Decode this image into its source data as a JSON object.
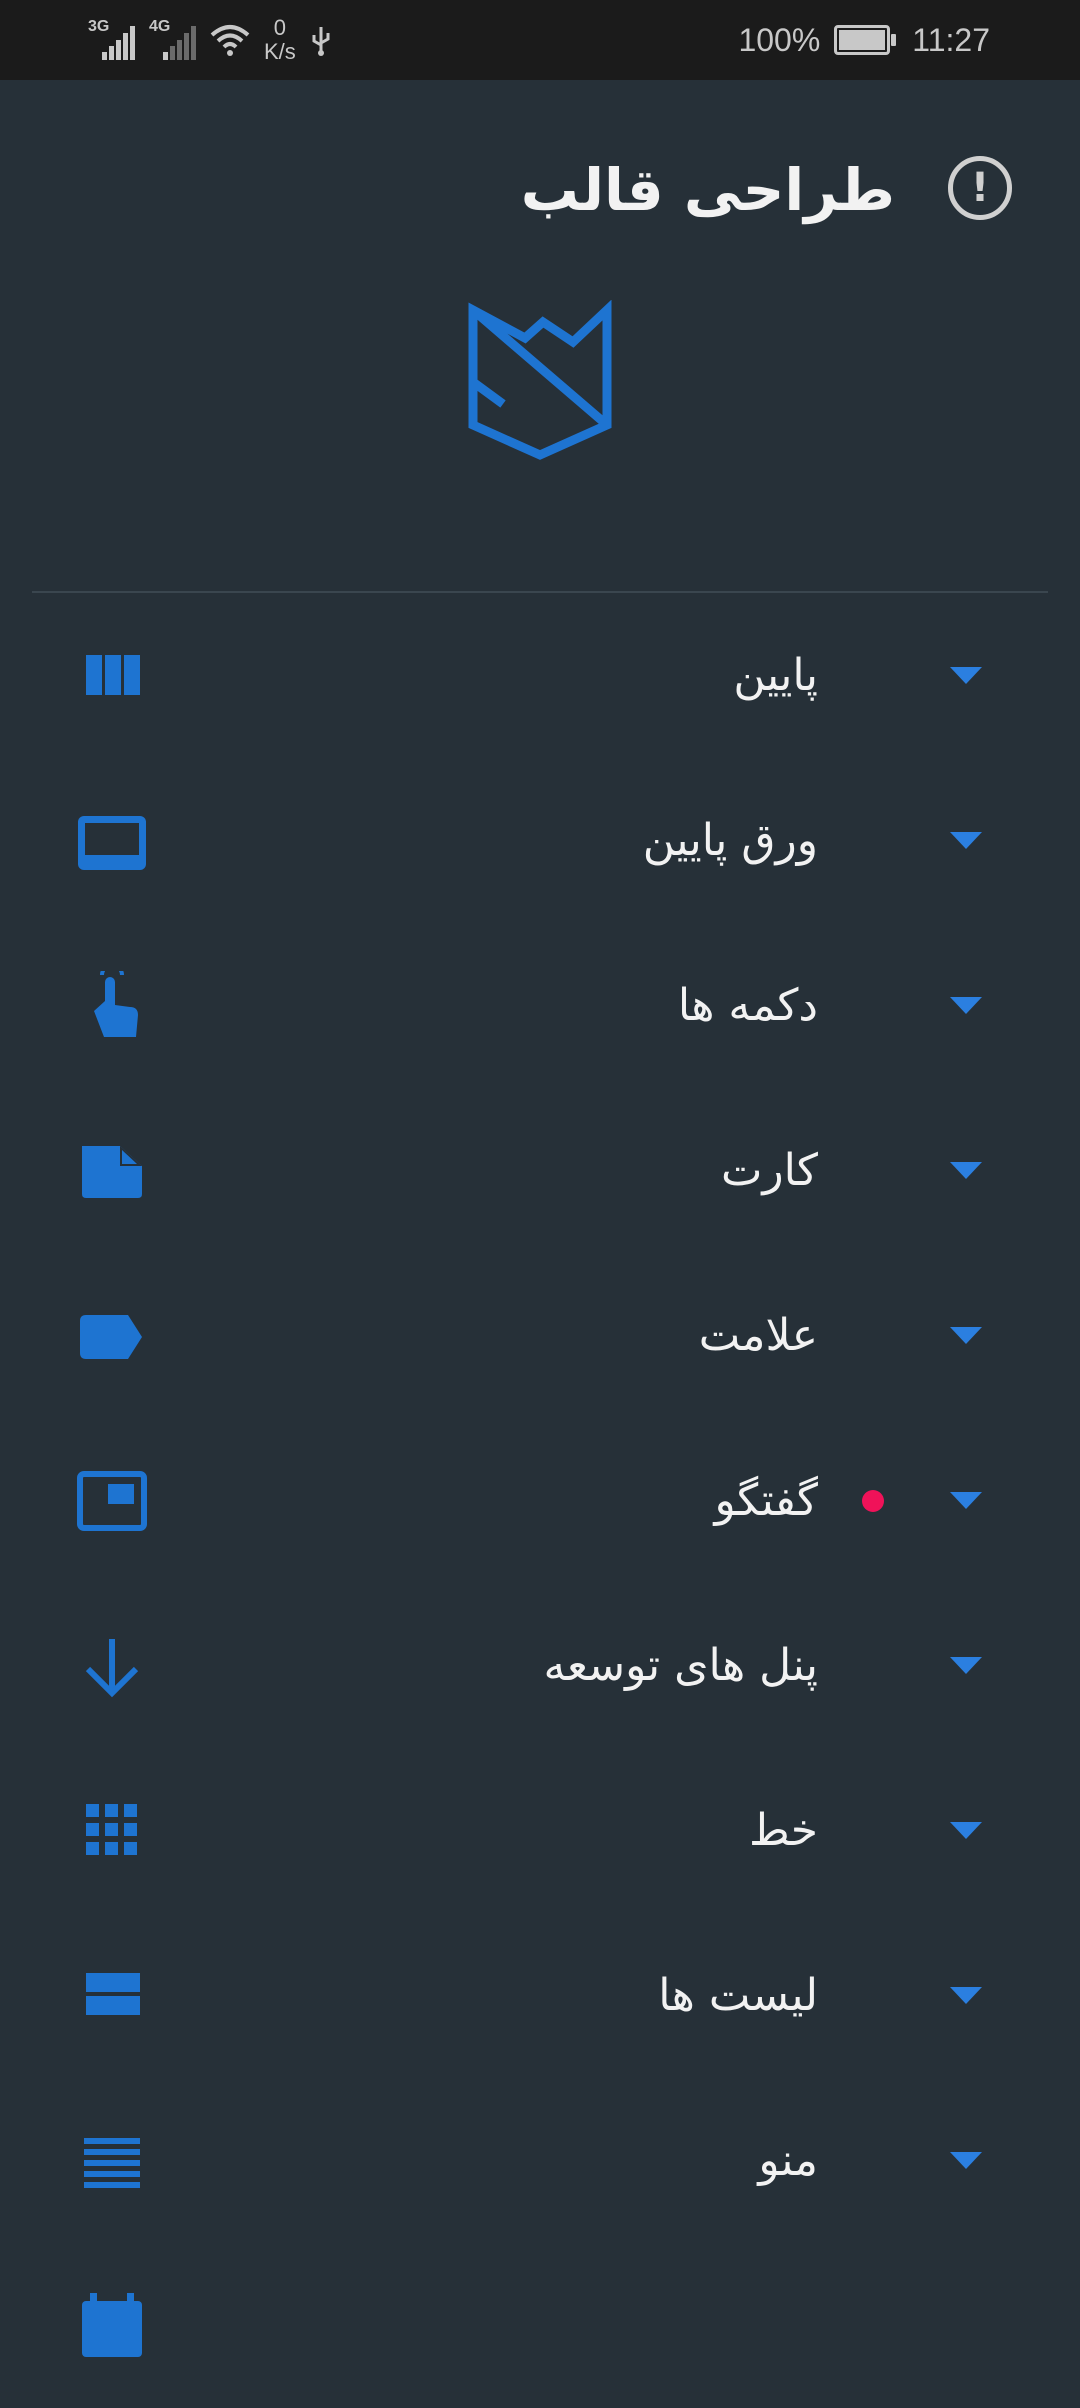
{
  "status_bar": {
    "network_1": "3G",
    "network_2": "4G",
    "speed_value": "0",
    "speed_unit": "K/s",
    "battery": "100%",
    "time": "11:27",
    "icons": [
      "signal-icon",
      "signal-weak-icon",
      "wifi-icon",
      "usb-icon",
      "battery-charging-icon"
    ]
  },
  "header": {
    "title": "طراحی قالب",
    "info_icon": "!"
  },
  "accent_color": "#2b7fe0",
  "badge_color": "#f01259",
  "menu": {
    "items": [
      {
        "label": "پایین",
        "icon": "view-column-icon"
      },
      {
        "label": "ورق پایین",
        "icon": "bottom-sheet-icon"
      },
      {
        "label": "دکمه ها",
        "icon": "touch-app-icon"
      },
      {
        "label": "کارت",
        "icon": "note-card-icon"
      },
      {
        "label": "علامت",
        "icon": "label-icon"
      },
      {
        "label": "گفتگو",
        "icon": "dialog-icon",
        "badge": true
      },
      {
        "label": "پنل های توسعه",
        "icon": "arrow-down-icon"
      },
      {
        "label": "خط",
        "icon": "grid-icon"
      },
      {
        "label": "لیست ها",
        "icon": "list-view-icon"
      },
      {
        "label": "منو",
        "icon": "menu-lines-icon"
      },
      {
        "label": "",
        "icon": "calendar-icon"
      }
    ]
  }
}
